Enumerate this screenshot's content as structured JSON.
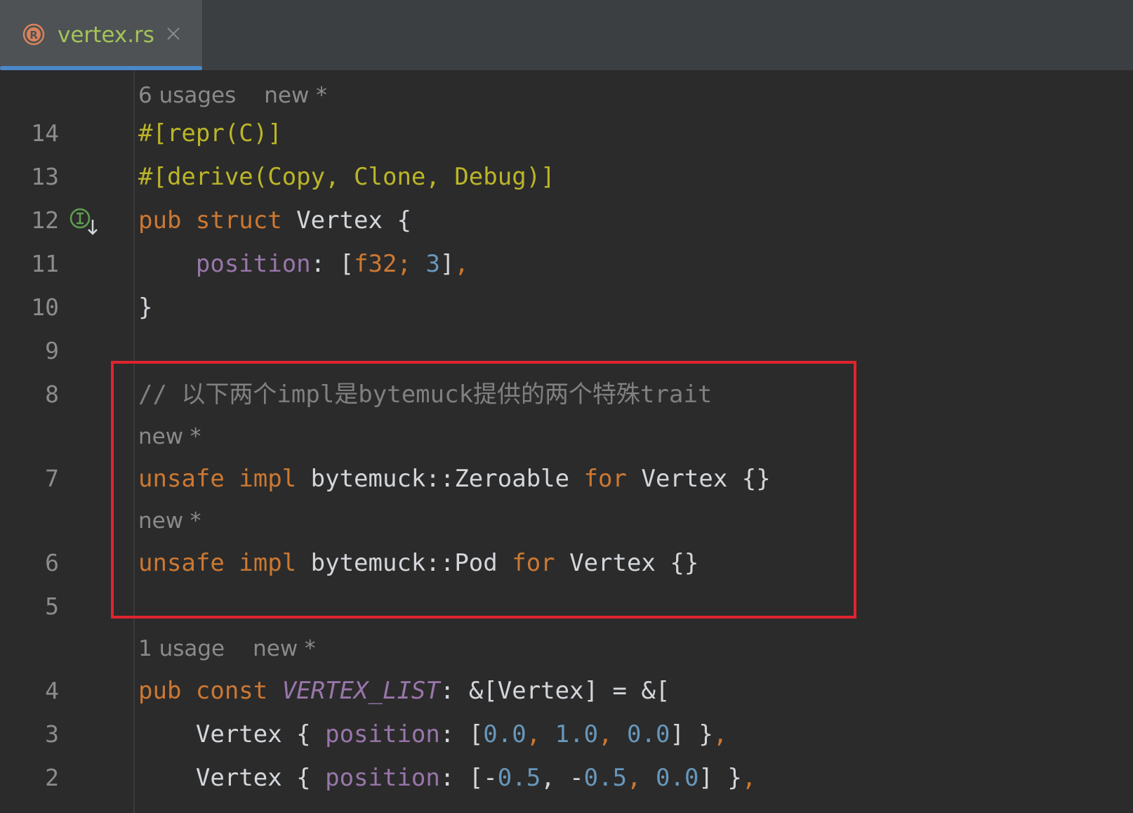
{
  "tab": {
    "title": "vertex.rs"
  },
  "hints": {
    "h1": {
      "usages": "6 usages",
      "author": "new *"
    },
    "h2": {
      "author": "new *"
    },
    "h3": {
      "author": "new *"
    },
    "h4": {
      "usages": "1 usage",
      "author": "new *"
    }
  },
  "lines": {
    "l14": {
      "no": "14",
      "p1": "#[repr(C)]"
    },
    "l13": {
      "no": "13",
      "p1": "#[derive(Copy, Clone, Debug)]"
    },
    "l12": {
      "no": "12",
      "p1": "pub struct",
      "p2": " Vertex {"
    },
    "l11": {
      "no": "11",
      "p0": "    ",
      "p1": "position",
      "p2": ": [",
      "p3": "f32; ",
      "p4": "3",
      "p5": "]",
      "p6": ","
    },
    "l10": {
      "no": "10",
      "p1": "}"
    },
    "l9": {
      "no": "9"
    },
    "l8": {
      "no": "8",
      "p1": "// 以下两个impl是bytemuck提供的两个特殊trait"
    },
    "l7": {
      "no": "7",
      "p1": "unsafe impl",
      "p2": " bytemuck::Zeroable ",
      "p3": "for",
      "p4": " Vertex {}"
    },
    "l6": {
      "no": "6",
      "p1": "unsafe impl",
      "p2": " bytemuck::Pod ",
      "p3": "for",
      "p4": " Vertex {}"
    },
    "l5": {
      "no": "5"
    },
    "l4": {
      "no": "4",
      "p1": "pub const ",
      "p2": "VERTEX_LIST",
      "p3": ": &[Vertex] = &["
    },
    "l3": {
      "no": "3",
      "p0": "    Vertex { ",
      "p1": "position",
      "p2": ": [",
      "p3": "0.0",
      "p4": ", ",
      "p5": "1.0",
      "p6": ", ",
      "p7": "0.0",
      "p8": "] }",
      "p9": ","
    },
    "l2": {
      "no": "2",
      "p0": "    Vertex { ",
      "p1": "position",
      "p2": ": [",
      "p3": "-",
      "p4": "0.5",
      "p5": ", -",
      "p6": "0.5",
      "p7": ", ",
      "p8": "0.0",
      "p9": "] }",
      "p10": ","
    }
  },
  "colors": {
    "keyword": "#cc7832",
    "attribute": "#bbb529",
    "field": "#9876aa",
    "number": "#6897bb",
    "comment": "#808080",
    "highlight_box": "#e0232f",
    "tab_title": "#a4c35a"
  },
  "icons": {
    "file": "rust-file-icon",
    "close": "close-icon",
    "gutter": "implemented-trait-icon"
  }
}
